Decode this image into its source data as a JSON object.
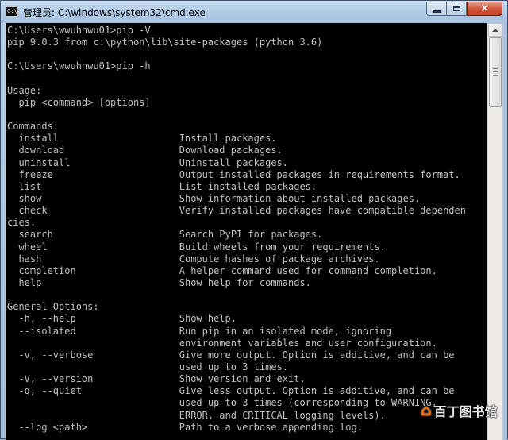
{
  "window": {
    "title": "管理员: C:\\windows\\system32\\cmd.exe",
    "app_icon_text": "C:\\"
  },
  "controls": {
    "minimize": "minimize-icon",
    "maximize": "maximize-icon",
    "close": "×"
  },
  "console": {
    "lines": [
      "C:\\Users\\wwuhnwu01>pip -V",
      "pip 9.0.3 from c:\\python\\lib\\site-packages (python 3.6)",
      "",
      "C:\\Users\\wwuhnwu01>pip -h",
      "",
      "Usage:",
      "  pip <command> [options]",
      "",
      "Commands:",
      "  install                     Install packages.",
      "  download                    Download packages.",
      "  uninstall                   Uninstall packages.",
      "  freeze                      Output installed packages in requirements format.",
      "  list                        List installed packages.",
      "  show                        Show information about installed packages.",
      "  check                       Verify installed packages have compatible dependen",
      "cies.",
      "  search                      Search PyPI for packages.",
      "  wheel                       Build wheels from your requirements.",
      "  hash                        Compute hashes of package archives.",
      "  completion                  A helper command used for command completion.",
      "  help                        Show help for commands.",
      "",
      "General Options:",
      "  -h, --help                  Show help.",
      "  --isolated                  Run pip in an isolated mode, ignoring",
      "                              environment variables and user configuration.",
      "  -v, --verbose               Give more output. Option is additive, and can be",
      "                              used up to 3 times.",
      "  -V, --version               Show version and exit.",
      "  -q, --quiet                 Give less output. Option is additive, and can be",
      "                              used up to 3 times (corresponding to WARNING,",
      "                              ERROR, and CRITICAL logging levels).",
      "  --log <path>                Path to a verbose appending log."
    ]
  },
  "watermark": {
    "logo": "⌂",
    "text": "百丁图书馆"
  },
  "colors": {
    "console_bg": "#000000",
    "console_fg": "#c0c0c0",
    "close_button": "#c84a2e"
  }
}
